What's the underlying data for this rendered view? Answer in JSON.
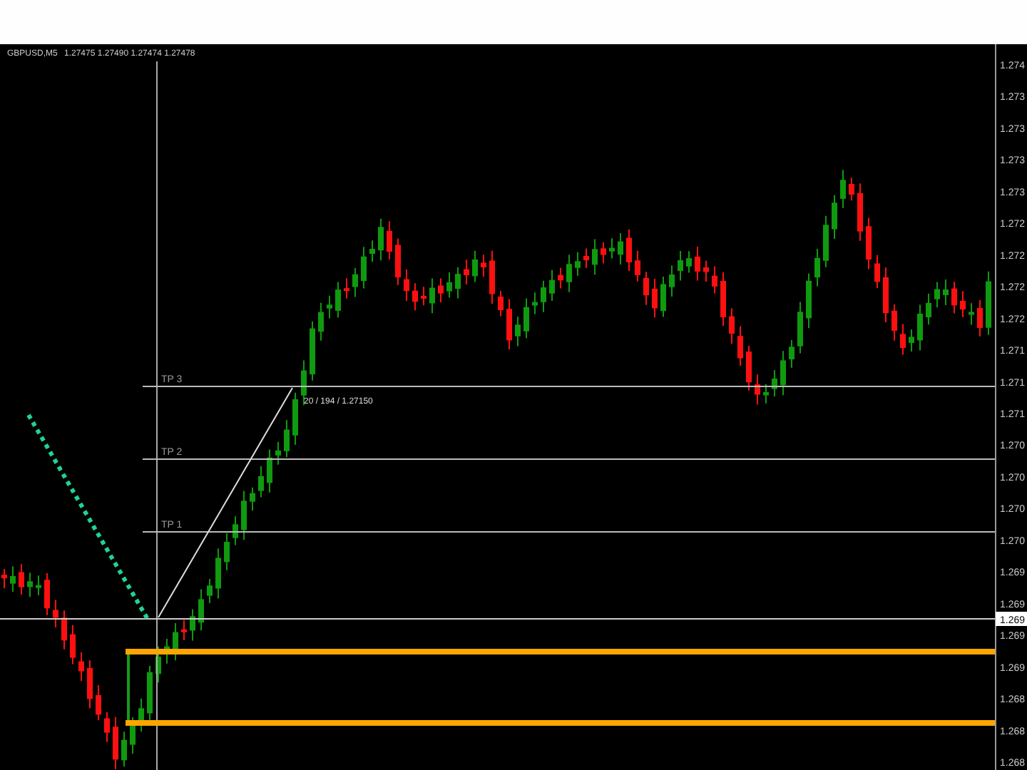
{
  "chart": {
    "symbol": "GBPUSD,M5",
    "quote": "1.27475 1.27490 1.27474 1.27478",
    "levels": [
      {
        "label": "TP 3"
      },
      {
        "label": "TP 2"
      },
      {
        "label": "TP 1"
      }
    ],
    "measure_label": "20 / 194 / 1.27150",
    "current_price": "1.269",
    "axis_labels": [
      "1.274",
      "1.273",
      "1.273",
      "1.273",
      "1.273",
      "1.272",
      "1.272",
      "1.272",
      "1.272",
      "1.271",
      "1.271",
      "1.271",
      "1.270",
      "1.270",
      "1.270",
      "1.270",
      "1.269",
      "1.269",
      "1.269",
      "1.269",
      "1.268",
      "1.268",
      "1.268"
    ]
  }
}
